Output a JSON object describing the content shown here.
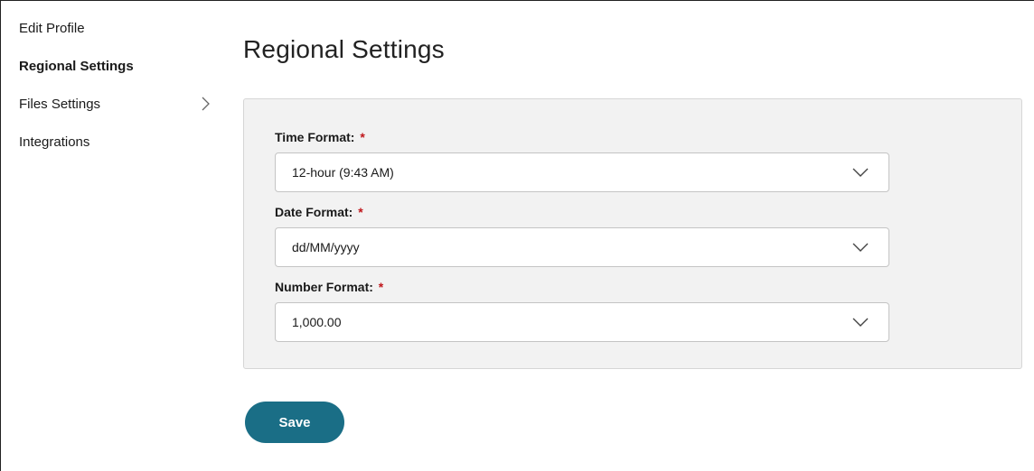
{
  "sidebar": {
    "items": [
      {
        "label": "Edit Profile"
      },
      {
        "label": "Regional Settings"
      },
      {
        "label": "Files Settings"
      },
      {
        "label": "Integrations"
      }
    ]
  },
  "main": {
    "title": "Regional Settings",
    "fields": [
      {
        "label": "Time Format:",
        "required_mark": "*",
        "value": "12-hour (9:43 AM)"
      },
      {
        "label": "Date Format:",
        "required_mark": "*",
        "value": "dd/MM/yyyy"
      },
      {
        "label": "Number Format:",
        "required_mark": "*",
        "value": "1,000.00"
      }
    ],
    "save_label": "Save"
  },
  "colors": {
    "accent": "#1a6e86",
    "required": "#c0161b",
    "panel_bg": "#f2f2f2"
  },
  "icons": {
    "files_settings": "chevron-right-icon",
    "select_caret": "chevron-down-icon"
  }
}
